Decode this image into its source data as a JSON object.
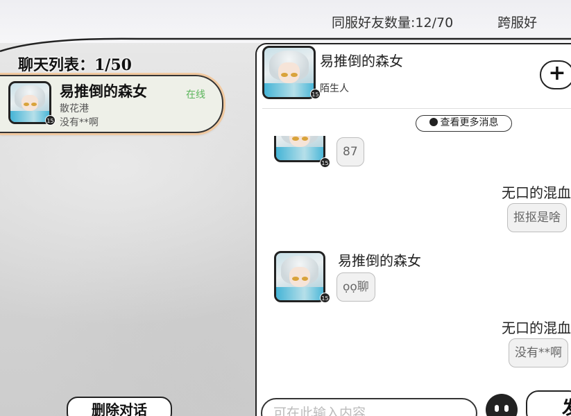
{
  "top": {
    "friends_label": "同服好友数量:",
    "friends_value": "12/70",
    "cross_label": "跨服好"
  },
  "chat_list": {
    "title": "聊天列表：1/50",
    "items": [
      {
        "name": "易推倒的森女",
        "status": "在线",
        "place": "散花港",
        "last_message": "没有**啊",
        "level": "15"
      }
    ],
    "delete_label": "删除对话"
  },
  "conversation": {
    "name": "易推倒的森女",
    "relation": "陌生人",
    "level": "15",
    "add_icon": "plus-icon",
    "more_label": "查看更多消息",
    "messages": [
      {
        "side": "left",
        "sender": "",
        "text": "87",
        "level": "15"
      },
      {
        "side": "right",
        "sender": "无口的混血",
        "text": "抠抠是啥"
      },
      {
        "side": "left",
        "sender": "易推倒的森女",
        "text": "ọọ聊",
        "level": "15"
      },
      {
        "side": "right",
        "sender": "无口的混血",
        "text": "没有**啊"
      }
    ],
    "input_placeholder": "可在此输入内容",
    "send_label": "发"
  },
  "colors": {
    "online": "#5bb55b",
    "card_outline": "#f1c9a0",
    "bubble_bg": "#f1f1f1"
  }
}
